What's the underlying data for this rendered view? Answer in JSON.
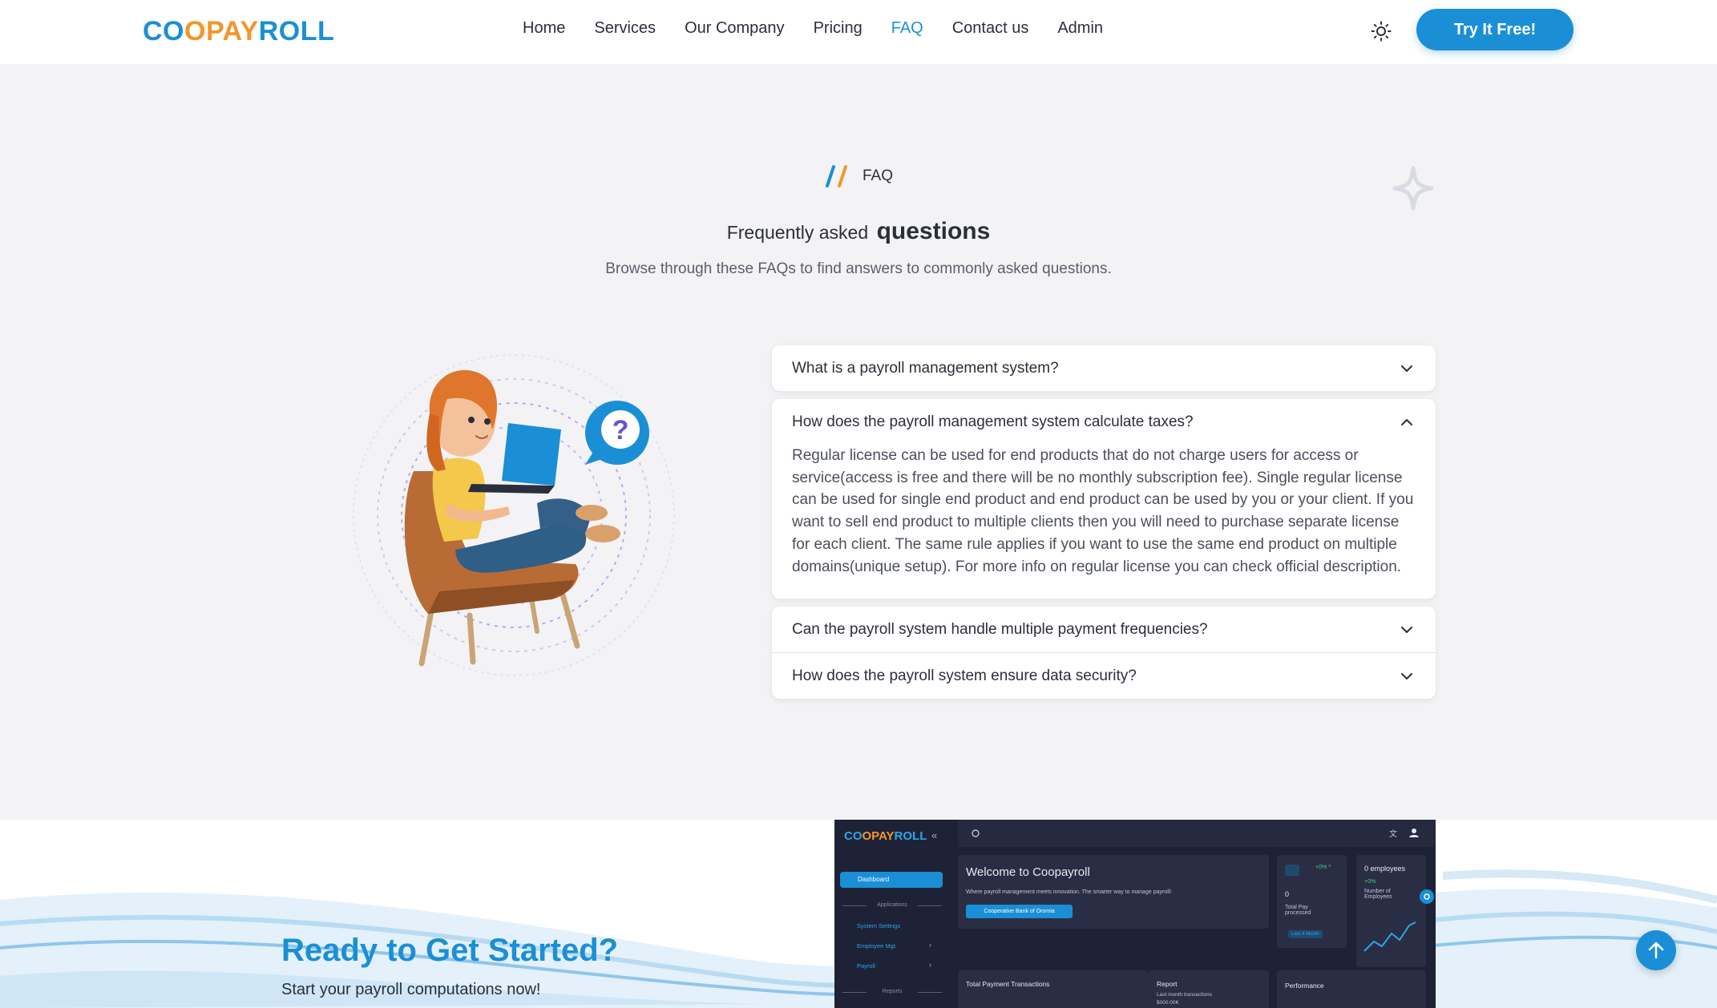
{
  "header": {
    "logo": {
      "part1": "CO",
      "part2": "O",
      "part3": "PAY",
      "part4": "ROLL"
    },
    "nav": [
      {
        "label": "Home"
      },
      {
        "label": "Services"
      },
      {
        "label": "Our Company"
      },
      {
        "label": "Pricing"
      },
      {
        "label": "FAQ",
        "active": true
      },
      {
        "label": "Contact us"
      },
      {
        "label": "Admin"
      }
    ],
    "theme_icon": "sun-icon",
    "cta_label": "Try It Free!"
  },
  "faq_section": {
    "kicker": "FAQ",
    "title_regular": "Frequently asked",
    "title_bold": "questions",
    "subtitle": "Browse through these FAQs to find answers to commonly asked questions.",
    "items": [
      {
        "question": "What is a payroll management system?",
        "expanded": false
      },
      {
        "question": "How does the payroll management system calculate taxes?",
        "expanded": true,
        "answer": "Regular license can be used for end products that do not charge users for access or service(access is free and there will be no monthly subscription fee). Single regular license can be used for single end product and end product can be used by you or your client. If you want to sell end product to multiple clients then you will need to purchase separate license for each client. The same rule applies if you want to use the same end product on multiple domains(unique setup). For more info on regular license you can check official description."
      },
      {
        "question": "Can the payroll system handle multiple payment frequencies?",
        "expanded": false
      },
      {
        "question": "How does the payroll system ensure data security?",
        "expanded": false
      }
    ]
  },
  "cta_band": {
    "title": "Ready to Get Started?",
    "subtitle": "Start your payroll computations now!"
  },
  "dashboard_preview": {
    "logo": {
      "part1": "CO",
      "part2": "O",
      "part3": "PAY",
      "part4": "ROLL"
    },
    "nav_active": "Dashboard",
    "section_applications": "Applications",
    "links": [
      "System Settings",
      "Employee Mgt.",
      "Payroll"
    ],
    "section_reports": "Reports",
    "welcome_title": "Welcome to Coopayroll",
    "welcome_sub": "Where payroll management meets innovation. The smarter way to manage payroll!",
    "welcome_button": "Cooperative Bank of Oromia",
    "stat1_pct": "+0% ^",
    "stat1_value": "0",
    "stat1_label": "Total Pay processed",
    "stat1_badge": "Last 4 Month",
    "stat2_title": "0 employees",
    "stat2_pct": "+0%",
    "stat2_label": "Number of Employees",
    "card_transactions": "Total Payment Transactions",
    "card_report": "Report",
    "card_report_sub": "Last month transactions",
    "card_report_value": "$000.00K",
    "card_performance": "Performance"
  }
}
